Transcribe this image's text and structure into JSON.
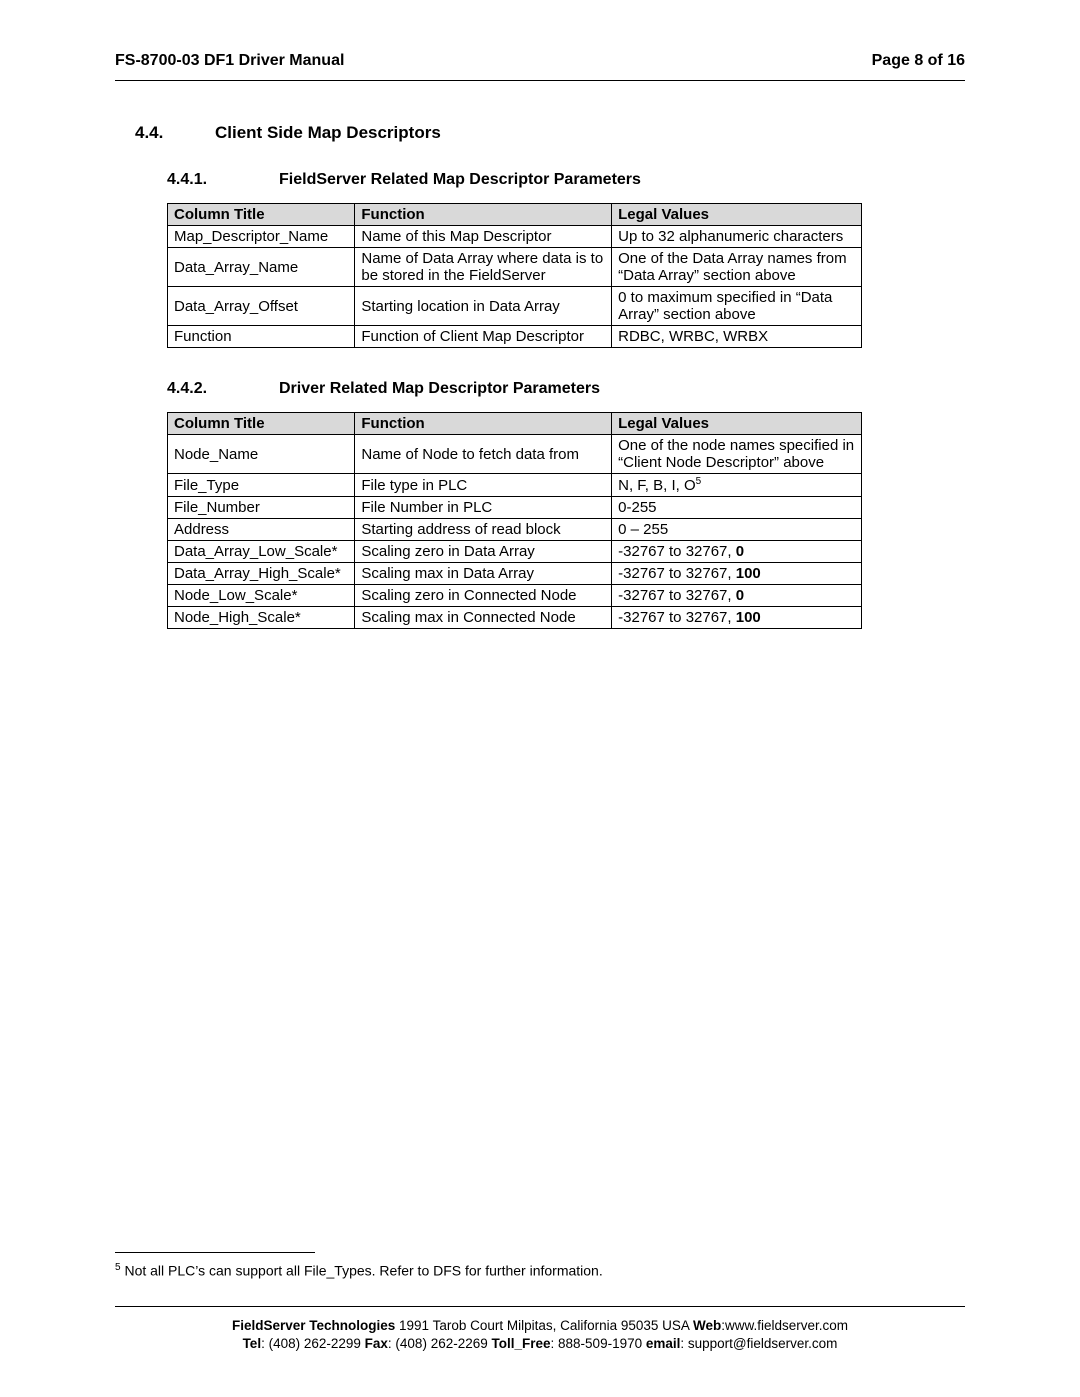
{
  "header": {
    "left": "FS-8700-03 DF1 Driver Manual",
    "right": "Page 8 of 16"
  },
  "section44": {
    "num": "4.4.",
    "title": "Client Side Map Descriptors"
  },
  "section441": {
    "num": "4.4.1.",
    "title": "FieldServer Related Map Descriptor Parameters",
    "headers": {
      "c0": "Column Title",
      "c1": "Function",
      "c2": "Legal Values"
    },
    "rows": [
      {
        "c0": "Map_Descriptor_Name",
        "c1": "Name of this Map Descriptor",
        "c2": "Up to 32 alphanumeric characters"
      },
      {
        "c0": "Data_Array_Name",
        "c1": "Name of Data Array where data is to be stored in the FieldServer",
        "c2": "One of the Data Array names from “Data Array” section above"
      },
      {
        "c0": "Data_Array_Offset",
        "c1": "Starting location in Data Array",
        "c2": "0 to maximum specified in “Data Array” section above"
      },
      {
        "c0": "Function",
        "c1": "Function of Client Map Descriptor",
        "c2": "RDBC, WRBC, WRBX"
      }
    ]
  },
  "section442": {
    "num": "4.4.2.",
    "title": "Driver Related Map Descriptor Parameters",
    "headers": {
      "c0": "Column Title",
      "c1": "Function",
      "c2": "Legal Values"
    },
    "rows": [
      {
        "c0": "Node_Name",
        "c1": "Name of Node to fetch data from",
        "c2": "One of the node names specified in “Client Node Descriptor” above"
      },
      {
        "c0": "File_Type",
        "c1": "File type in PLC",
        "c2_prefix": "N, F, B, I, O",
        "c2_sup": "5"
      },
      {
        "c0": "File_Number",
        "c1": "File Number in PLC",
        "c2": "0-255"
      },
      {
        "c0": "Address",
        "c1": "Starting address of read block",
        "c2": "0 – 255"
      },
      {
        "c0": "Data_Array_Low_Scale*",
        "c1": "Scaling zero in Data Array",
        "c2_prefix": "-32767 to 32767, ",
        "c2_bold": "0"
      },
      {
        "c0": "Data_Array_High_Scale*",
        "c1": "Scaling max in Data Array",
        "c2_prefix": "-32767 to 32767, ",
        "c2_bold": "100"
      },
      {
        "c0": "Node_Low_Scale*",
        "c1": "Scaling zero in Connected Node",
        "c2_prefix": "-32767 to 32767, ",
        "c2_bold": "0"
      },
      {
        "c0": "Node_High_Scale*",
        "c1": "Scaling max in Connected Node",
        "c2_prefix": "-32767 to 32767, ",
        "c2_bold": "100"
      }
    ]
  },
  "footnote": {
    "marker": "5",
    "text": " Not all PLC’s can support all File_Types.  Refer to DFS for further information."
  },
  "footer": {
    "company": "FieldServer Technologies",
    "address": " 1991 Tarob Court Milpitas, California 95035 USA  ",
    "web_label": "Web",
    "web": ":www.fieldserver.com",
    "tel_label": "Tel",
    "tel": ": (408) 262-2299   ",
    "fax_label": "Fax",
    "fax": ": (408) 262-2269   ",
    "toll_label": "Toll_Free",
    "toll": ": 888-509-1970   ",
    "email_label": "email",
    "email": ": support@fieldserver.com"
  }
}
